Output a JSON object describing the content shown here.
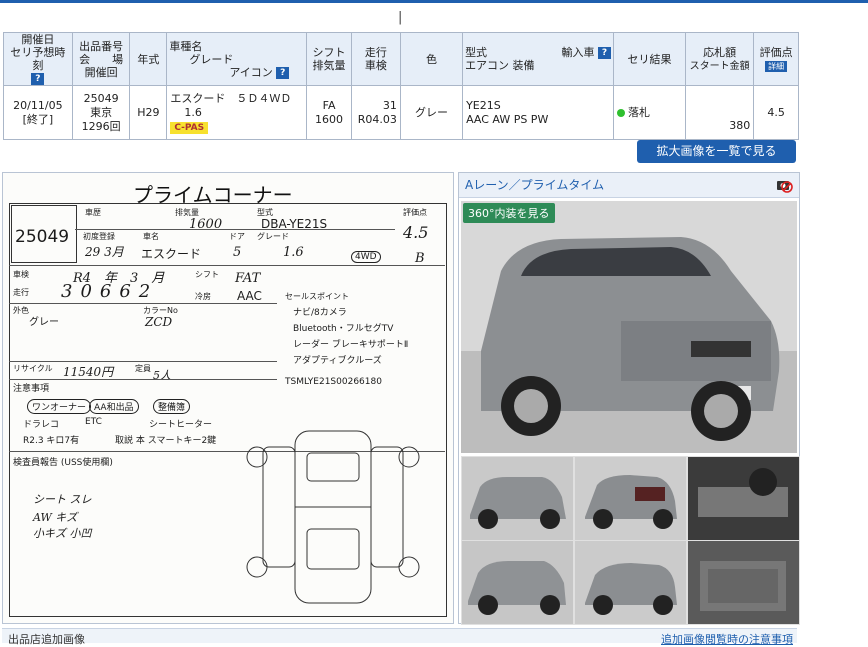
{
  "header_caret": "|",
  "table": {
    "headers": {
      "date": [
        "開催日",
        "セリ予想時刻"
      ],
      "lot": [
        "出品番号",
        "会　　場",
        "開催回"
      ],
      "year": "年式",
      "car": [
        "車種名",
        "グレード",
        "アイコン"
      ],
      "shift": [
        "シフト",
        "排気量"
      ],
      "mileage": [
        "走行",
        "車検"
      ],
      "color": "色",
      "model": [
        "型式",
        "エアコン 装備"
      ],
      "import": "輸入車",
      "result": "セリ結果",
      "price": [
        "応札額",
        "スタート金額"
      ],
      "score": "評価点",
      "score_badge": "詳細"
    },
    "row": {
      "date": "20/11/05",
      "status": "[終了]",
      "lot_no": "25049",
      "venue": "東京",
      "session": "1296回",
      "year": "H29",
      "car_name": "エスクード　５Ｄ４ＷＤ",
      "grade": "1.6",
      "icon": "C-PAS",
      "shift": "FA",
      "displacement": "1600",
      "mileage": "31",
      "inspection": "R04.03",
      "color": "グレー",
      "model_code": "YE21S",
      "equipment": "AAC AW PS PW",
      "result": "落札",
      "start_price": "380",
      "score": "4.5"
    },
    "help_glyph": "?"
  },
  "view_all_button": "拡大画像を一覧で見る",
  "sheet": {
    "title": "プライムコーナー",
    "lot": "25049",
    "labels": {
      "reg": "車歴",
      "disp": "排気量",
      "model": "型式",
      "eval": "評価点",
      "first_reg": "初度登録",
      "name": "車名",
      "door": "ドア",
      "grade": "グレード",
      "inspect": "車検",
      "year_unit": "年",
      "month_unit": "月",
      "shift": "シフト",
      "mileage": "走行",
      "ac": "冷房",
      "color": "外色",
      "colorno": "カラーNo",
      "points": "セールスポイント",
      "recycle": "リサイクル",
      "cap": "定員",
      "note": "注意事項",
      "report": "検査員報告 (USS使用欄)"
    },
    "hw": {
      "disp": "1600",
      "model": "DBA-YE21S",
      "eval": "4.5",
      "interior": "B",
      "first_reg": "29 3月",
      "name": "エスクード",
      "door": "5",
      "grade": "1.6",
      "drive": "4WD",
      "inspect": "R4　年　3　月",
      "mileage": "30662",
      "shift": "FAT",
      "ac": "AAC",
      "color": "グレー",
      "colorno": "ZCD",
      "point1": "ナビ/8カメラ",
      "point2": "Bluetooth・フルセグTV",
      "point3": "レーダー ブレーキサポートⅡ",
      "point4": "アダプティブクルーズ",
      "recycle": "11540円",
      "cap": "5人",
      "reg_plate": "TSMLYE21S00266180",
      "note1": "ワンオーナー",
      "note2": "AA和出品",
      "note3": "整備簿",
      "note4": "ドラレコ",
      "note5": "ETC",
      "note6": "シートヒーター",
      "note7": "R2.3 キロ7有",
      "note8": "取説 本 スマートキー2鍵",
      "report1": "シート スレ",
      "report2": "AW キズ",
      "report3": "小キズ 小凹"
    }
  },
  "pane": {
    "title": "Aレーン／プライムタイム",
    "btn_360": "360°内装を見る"
  },
  "bottom": {
    "left": "出品店追加画像",
    "right": "追加画像閲覧時の注意事項"
  },
  "colors": {
    "accent": "#1f5fae",
    "header_bg": "#e6eef8",
    "sold_dot": "#2fc02f",
    "cpas": "#f7e12e"
  }
}
